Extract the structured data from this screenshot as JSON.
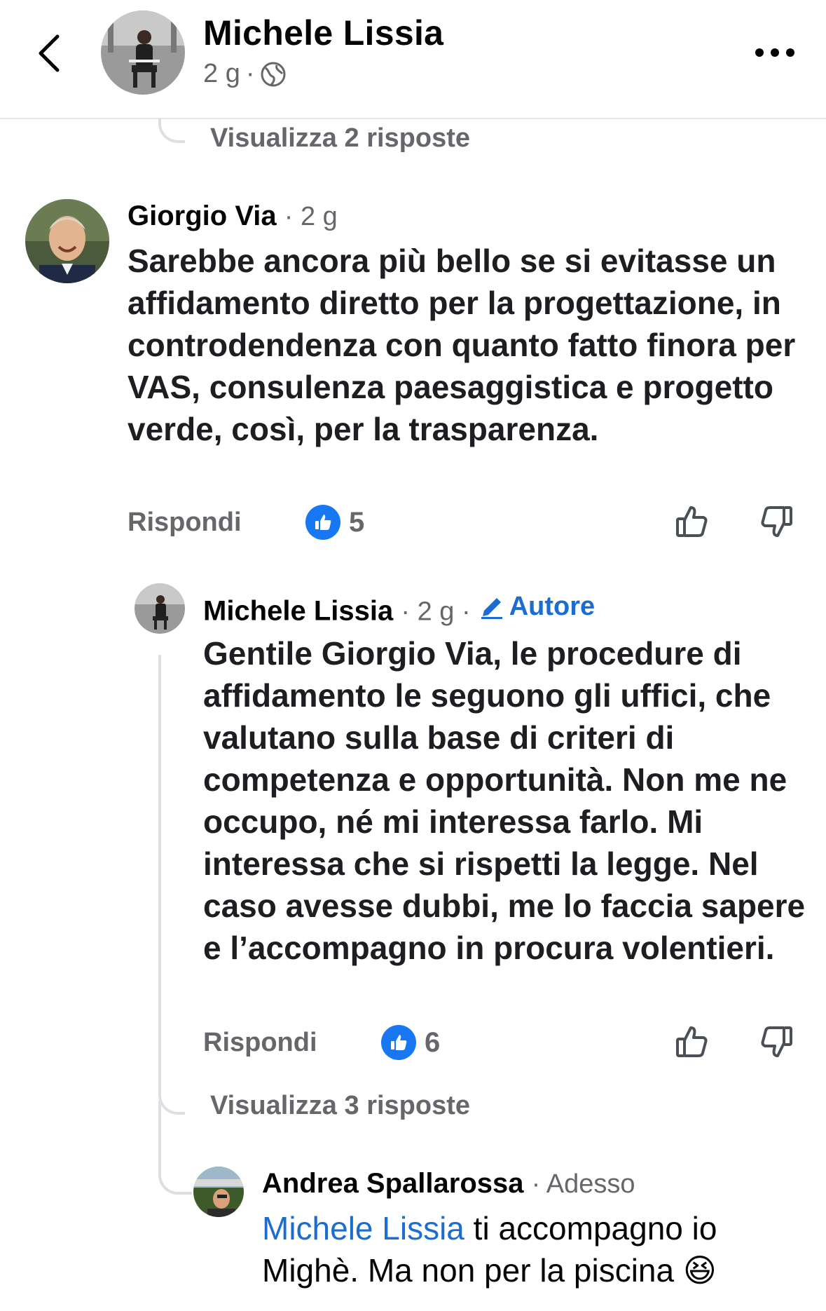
{
  "header": {
    "name": "Michele Lissia",
    "time": "2 g",
    "separator": "·"
  },
  "thread": {
    "view_replies_top": "Visualizza 2 risposte",
    "view_replies_mid": "Visualizza 3 risposte"
  },
  "comments": [
    {
      "author": "Giorgio Via",
      "time": "· 2 g",
      "text": "Sarebbe ancora più bello se si evitasse un affidamento diretto per la progettazione, in controdendenza con quanto fatto finora per VAS, consulenza paesaggistica e progetto verde, così, per la trasparenza.",
      "reply_label": "Rispondi",
      "likes": "5"
    },
    {
      "author": "Michele Lissia",
      "time": "· 2 g ·",
      "badge": "Autore",
      "text": "Gentile Giorgio Via, le procedure di affidamento le seguono gli uffici, che valutano sulla base di criteri di competenza e opportunità. Non me ne occupo, né mi interessa farlo. Mi interessa che si rispetti la legge. Nel caso avesse dubbi, me lo faccia sapere e l’accompagno in procura volentieri.",
      "reply_label": "Rispondi",
      "likes": "6"
    },
    {
      "author": "Andrea Spallarossa",
      "time": "· Adesso",
      "mention": "Michele Lissia",
      "text": " ti accompagno io Mighè. Ma non per la piscina",
      "emoji": "😆"
    }
  ],
  "colors": {
    "accent": "#1877f2",
    "link": "#1c6dd0",
    "secondary_text": "#65676b",
    "thread_line": "#dddfe3"
  },
  "icons": [
    "back-arrow-icon",
    "globe-icon",
    "more-icon",
    "like-reaction-icon",
    "thumbs-up-icon",
    "thumbs-down-icon",
    "pencil-icon"
  ]
}
